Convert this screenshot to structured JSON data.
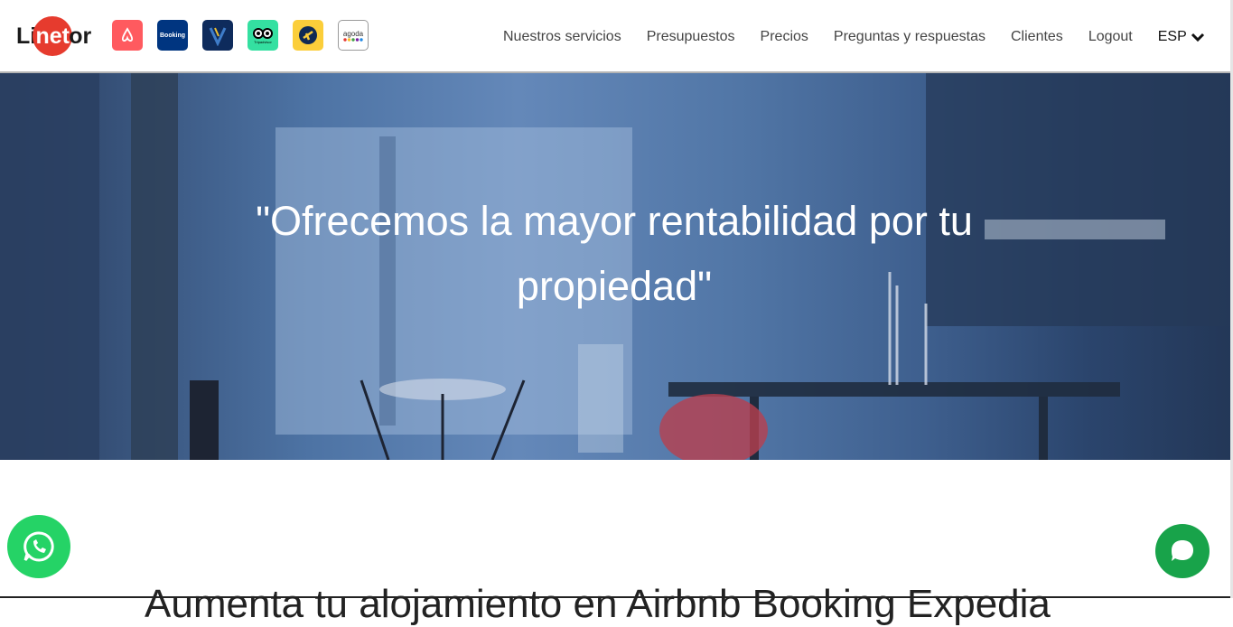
{
  "brand": {
    "prefix": "Li",
    "circle": "net",
    "suffix": "or",
    "accent": "#e63b2e"
  },
  "platforms": [
    {
      "name": "airbnb-icon",
      "label": "",
      "color": "#ff5a5f"
    },
    {
      "name": "booking-icon",
      "label": "Booking",
      "color": "#003580"
    },
    {
      "name": "vrbo-icon",
      "label": "",
      "color": "#0e2b5c"
    },
    {
      "name": "tripadvisor-icon",
      "label": "Tripadvisor",
      "color": "#34e0a1"
    },
    {
      "name": "expedia-icon",
      "label": "",
      "color": "#fbce3a"
    },
    {
      "name": "agoda-icon",
      "label": "agoda",
      "color": "#ffffff"
    }
  ],
  "nav": {
    "items": [
      "Nuestros servicios",
      "Presupuestos",
      "Precios",
      "Preguntas y respuestas",
      "Clientes",
      "Logout"
    ],
    "language": "ESP"
  },
  "hero": {
    "quote": "\"Ofrecemos la mayor rentabilidad por tu propiedad\""
  },
  "section": {
    "heading_partial": "Aumenta tu alojamiento en Airbnb Booking Expedia"
  },
  "widgets": {
    "whatsapp_color": "#25d366",
    "chat_color": "#18a34a"
  }
}
